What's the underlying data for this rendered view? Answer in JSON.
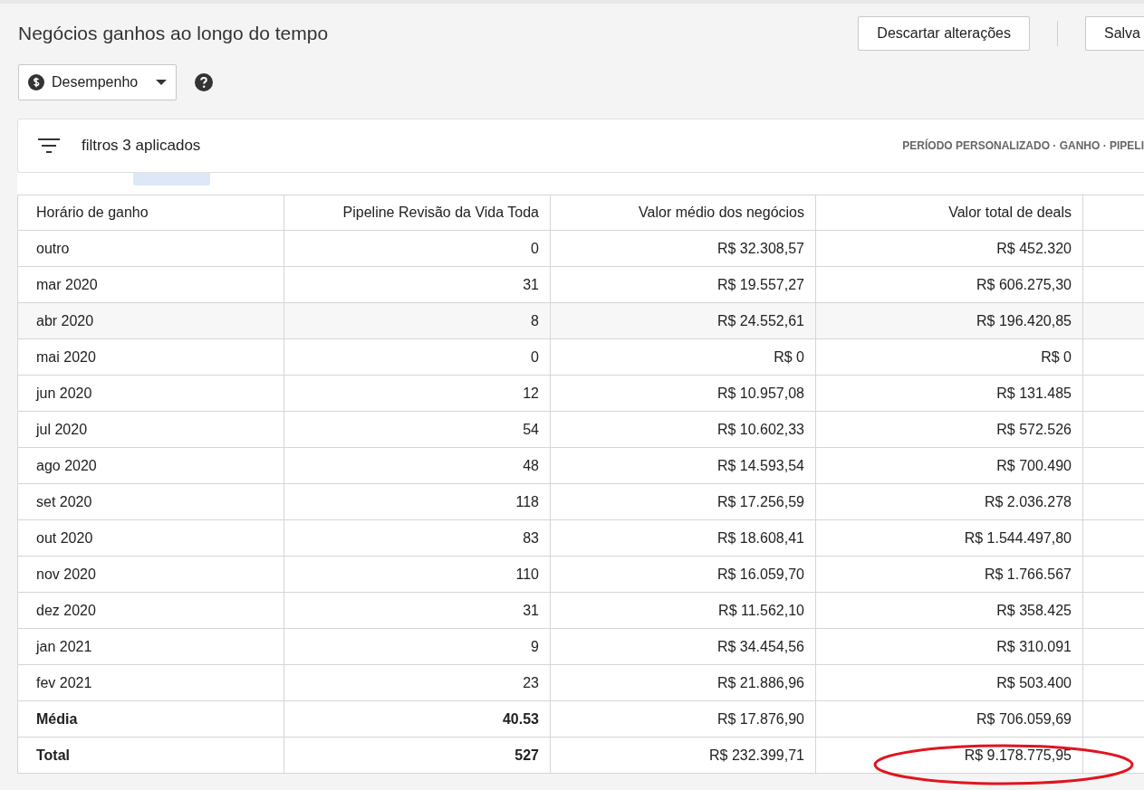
{
  "title": "Negócios ganhos ao longo do tempo",
  "actions": [
    {
      "label": "Descartar alterações"
    },
    {
      "label": "Salva"
    }
  ],
  "view_selector": {
    "label": "Desempenho"
  },
  "filters": {
    "label": "filtros 3 aplicados",
    "summary": "PERÍODO PERSONALIZADO · GANHO · PIPELI"
  },
  "table": {
    "columns": [
      "Horário de ganho",
      "Pipeline Revisão da Vida Toda",
      "Valor médio dos negócios",
      "Valor total de deals"
    ],
    "rows": [
      {
        "kind": "data",
        "hovered": false,
        "circled": false,
        "cells": [
          "outro",
          "0",
          "R$ 32.308,57",
          "R$ 452.320"
        ]
      },
      {
        "kind": "data",
        "hovered": false,
        "circled": false,
        "cells": [
          "mar 2020",
          "31",
          "R$ 19.557,27",
          "R$ 606.275,30"
        ]
      },
      {
        "kind": "data",
        "hovered": true,
        "circled": false,
        "cells": [
          "abr 2020",
          "8",
          "R$ 24.552,61",
          "R$ 196.420,85"
        ]
      },
      {
        "kind": "data",
        "hovered": false,
        "circled": false,
        "cells": [
          "mai 2020",
          "0",
          "R$ 0",
          "R$ 0"
        ]
      },
      {
        "kind": "data",
        "hovered": false,
        "circled": false,
        "cells": [
          "jun 2020",
          "12",
          "R$ 10.957,08",
          "R$ 131.485"
        ]
      },
      {
        "kind": "data",
        "hovered": false,
        "circled": false,
        "cells": [
          "jul 2020",
          "54",
          "R$ 10.602,33",
          "R$ 572.526"
        ]
      },
      {
        "kind": "data",
        "hovered": false,
        "circled": false,
        "cells": [
          "ago 2020",
          "48",
          "R$ 14.593,54",
          "R$ 700.490"
        ]
      },
      {
        "kind": "data",
        "hovered": false,
        "circled": false,
        "cells": [
          "set 2020",
          "118",
          "R$ 17.256,59",
          "R$ 2.036.278"
        ]
      },
      {
        "kind": "data",
        "hovered": false,
        "circled": false,
        "cells": [
          "out 2020",
          "83",
          "R$ 18.608,41",
          "R$ 1.544.497,80"
        ]
      },
      {
        "kind": "data",
        "hovered": false,
        "circled": false,
        "cells": [
          "nov 2020",
          "110",
          "R$ 16.059,70",
          "R$ 1.766.567"
        ]
      },
      {
        "kind": "data",
        "hovered": false,
        "circled": false,
        "cells": [
          "dez 2020",
          "31",
          "R$ 11.562,10",
          "R$ 358.425"
        ]
      },
      {
        "kind": "data",
        "hovered": false,
        "circled": false,
        "cells": [
          "jan 2021",
          "9",
          "R$ 34.454,56",
          "R$ 310.091"
        ]
      },
      {
        "kind": "data",
        "hovered": false,
        "circled": false,
        "cells": [
          "fev 2021",
          "23",
          "R$ 21.886,96",
          "R$ 503.400"
        ]
      },
      {
        "kind": "summary",
        "hovered": false,
        "circled": false,
        "cells": [
          "Média",
          "40.53",
          "R$ 17.876,90",
          "R$ 706.059,69"
        ]
      },
      {
        "kind": "summary",
        "hovered": false,
        "circled": true,
        "cells": [
          "Total",
          "527",
          "R$ 232.399,71",
          "R$ 9.178.775,95"
        ]
      }
    ]
  }
}
